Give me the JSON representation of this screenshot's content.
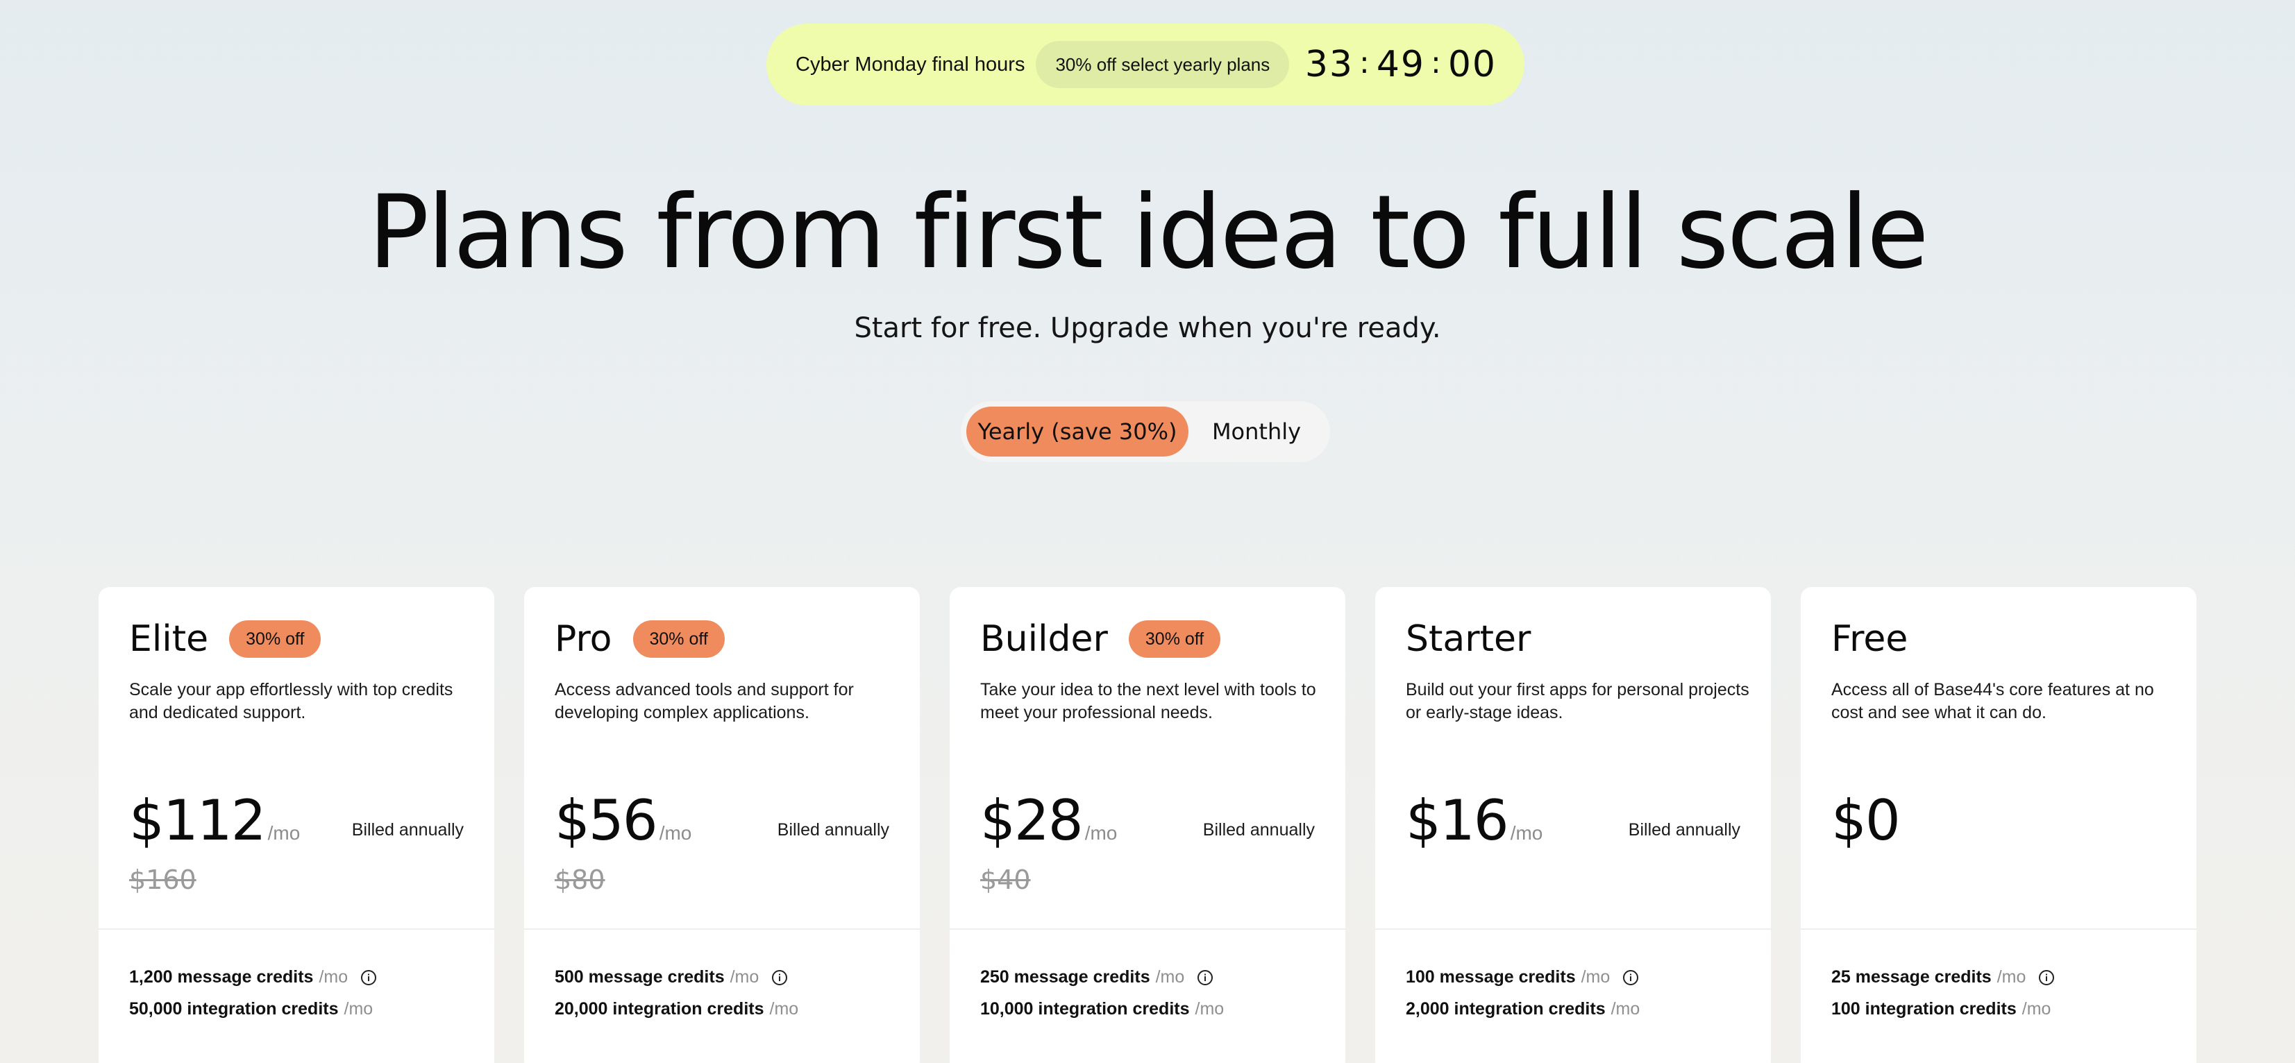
{
  "promo": {
    "label": "Cyber Monday final hours",
    "offer": "30% off select yearly plans",
    "countdown": {
      "hours": "33",
      "minutes": "49",
      "seconds": "00",
      "separator": ":"
    }
  },
  "hero": {
    "title": "Plans from first idea to full scale",
    "subtitle": "Start for free. Upgrade when you're ready."
  },
  "billing_toggle": {
    "yearly_label": "Yearly (save 30%)",
    "monthly_label": "Monthly",
    "selected": "yearly"
  },
  "colors": {
    "promo_bg": "#eefcab",
    "accent_orange": "#ef8b5d",
    "card_bg": "#ffffff"
  },
  "plans": [
    {
      "name": "Elite",
      "badge": "30% off",
      "description": "Scale your app effortlessly with top credits and dedicated support.",
      "price": "$112",
      "per": "/mo",
      "billed": "Billed annually",
      "old_price": "$160",
      "message_credits": "1,200 message credits",
      "integration_credits": "50,000 integration credits",
      "unit": "/mo"
    },
    {
      "name": "Pro",
      "badge": "30% off",
      "description": "Access advanced tools and support for developing complex applications.",
      "price": "$56",
      "per": "/mo",
      "billed": "Billed annually",
      "old_price": "$80",
      "message_credits": "500 message credits",
      "integration_credits": "20,000 integration credits",
      "unit": "/mo"
    },
    {
      "name": "Builder",
      "badge": "30% off",
      "description": "Take your idea to the next level with tools to meet your professional needs.",
      "price": "$28",
      "per": "/mo",
      "billed": "Billed annually",
      "old_price": "$40",
      "message_credits": "250 message credits",
      "integration_credits": "10,000 integration credits",
      "unit": "/mo"
    },
    {
      "name": "Starter",
      "description": "Build out your first apps for personal projects or early-stage ideas.",
      "price": "$16",
      "per": "/mo",
      "billed": "Billed annually",
      "message_credits": "100 message credits",
      "integration_credits": "2,000 integration credits",
      "unit": "/mo"
    },
    {
      "name": "Free",
      "description": "Access all of Base44's core features at no cost and see what it can do.",
      "price": "$0",
      "message_credits": "25 message credits",
      "integration_credits": "100 integration credits",
      "unit": "/mo"
    }
  ]
}
